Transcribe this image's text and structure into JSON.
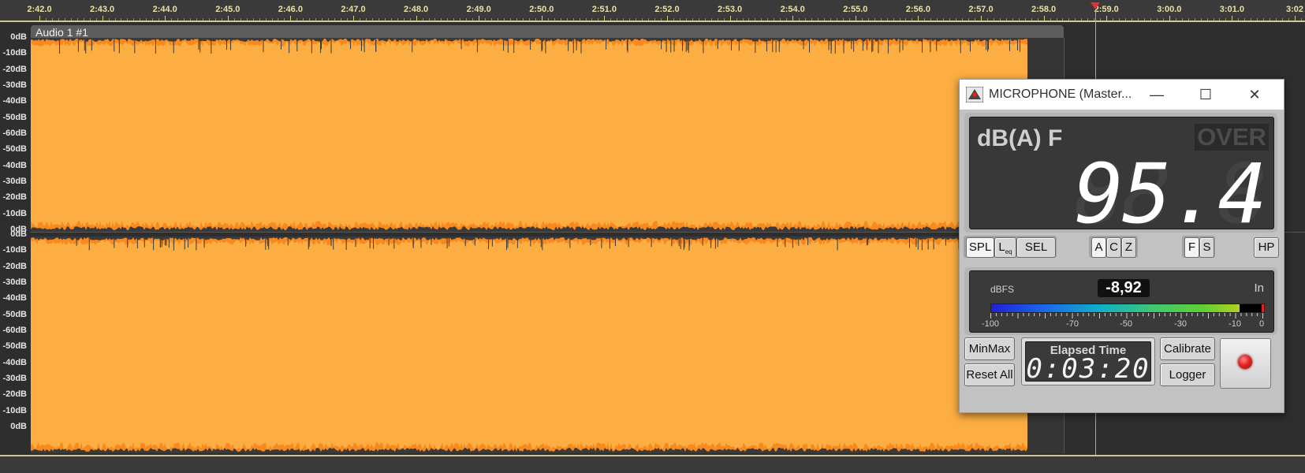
{
  "timeline": {
    "labels": [
      "2:42.0",
      "2:43.0",
      "2:44.0",
      "2:45.0",
      "2:46.0",
      "2:47.0",
      "2:48.0",
      "2:49.0",
      "2:50.0",
      "2:51.0",
      "2:52.0",
      "2:53.0",
      "2:54.0",
      "2:55.0",
      "2:56.0",
      "2:57.0",
      "2:58.0",
      "2:59.0",
      "3:00.0",
      "3:01.0",
      "3:02"
    ]
  },
  "track": {
    "clip_title": "Audio 1 #1",
    "db_scale_ch1": [
      "0dB",
      "-10dB",
      "-20dB",
      "-30dB",
      "-40dB",
      "-50dB",
      "-60dB",
      "-50dB",
      "-40dB",
      "-30dB",
      "-20dB",
      "-10dB",
      "0dB"
    ],
    "db_scale_ch2": [
      "0dB",
      "-10dB",
      "-20dB",
      "-30dB",
      "-40dB",
      "-50dB",
      "-60dB",
      "-50dB",
      "-40dB",
      "-30dB",
      "-20dB",
      "-10dB",
      "0dB"
    ],
    "wave_color": "#fdae42",
    "peak_color": "#f7891f",
    "bg_color": "#2e2e2e"
  },
  "meter": {
    "window_title": "MICROPHONE (Master...",
    "window_buttons": {
      "minimize": "—",
      "maximize": "☐",
      "close": "✕"
    },
    "weighting_label": "dB(A) F",
    "over_label": "OVER",
    "level_ghost": "88.8",
    "level": "95.4",
    "buttons": {
      "spl": "SPL",
      "leq": "L",
      "leq_sub": "eq",
      "sel": "SEL",
      "a": "A",
      "c": "C",
      "z": "Z",
      "f": "F",
      "s": "S",
      "hp": "HP",
      "minmax": "MinMax",
      "reset_all": "Reset All",
      "calibrate": "Calibrate",
      "logger": "Logger"
    },
    "dbfs_label": "dBFS",
    "dbfs_value": "-8,92",
    "input_label": "In",
    "dbfs_level": -8.92,
    "dbfs_peak": -1,
    "dbfs_scale": [
      "-100",
      "-70",
      "-50",
      "-30",
      "-10",
      "0"
    ],
    "elapsed_label": "Elapsed Time",
    "elapsed_time": "0:03:20"
  }
}
